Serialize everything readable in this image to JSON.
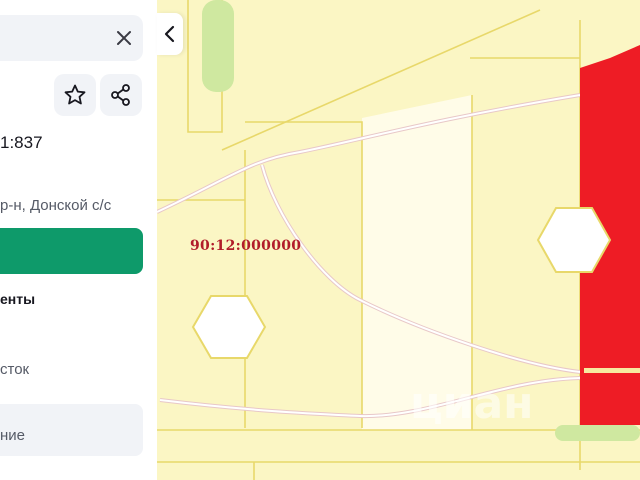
{
  "panel": {
    "cadastral_number": "1:837",
    "address": "р-н, Донской с/с",
    "documents_heading": "енты",
    "land_type": "сток",
    "row_label": "ние",
    "icons": {
      "close": "close-icon",
      "favorite": "star-icon",
      "share": "share-icon"
    }
  },
  "map": {
    "quarter_label": "90:12:000000",
    "watermark": "циан",
    "colors": {
      "background": "#fbf6c4",
      "parcel_border": "#e8d86a",
      "selected_parcel": "#ee1c25",
      "accent_green": "#0e9a6a"
    }
  },
  "controls": {
    "collapse_icon": "chevron-left-icon"
  }
}
